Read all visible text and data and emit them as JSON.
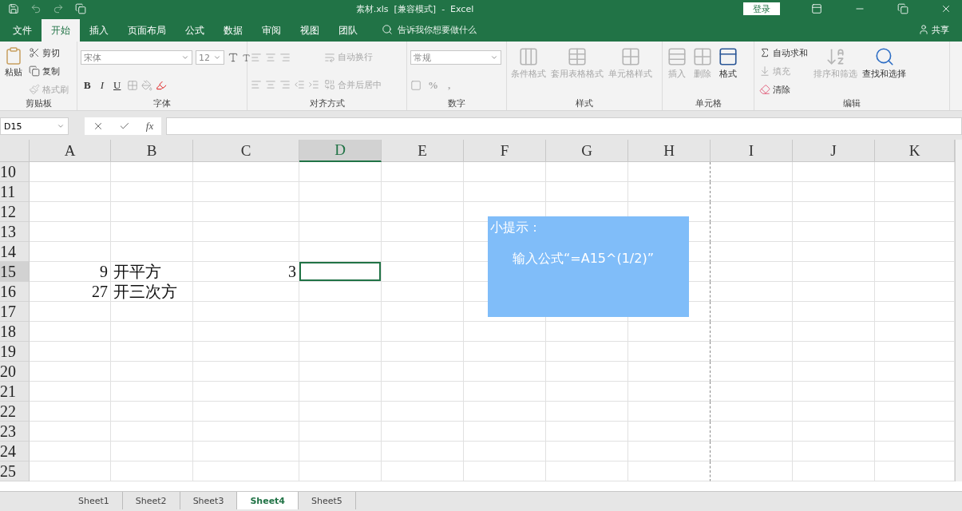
{
  "window": {
    "title": "素材.xls  [兼容模式]  -  Excel",
    "login": "登录"
  },
  "menu_tabs": [
    {
      "label": "文件",
      "selected": false
    },
    {
      "label": "开始",
      "selected": true
    },
    {
      "label": "插入",
      "selected": false
    },
    {
      "label": "页面布局",
      "selected": false
    },
    {
      "label": "公式",
      "selected": false
    },
    {
      "label": "数据",
      "selected": false
    },
    {
      "label": "审阅",
      "selected": false
    },
    {
      "label": "视图",
      "selected": false
    },
    {
      "label": "团队",
      "selected": false
    }
  ],
  "tell_me": {
    "placeholder": "告诉我你想要做什么"
  },
  "share": "共享",
  "ribbon": [
    {
      "kind": "clipboard",
      "label": "剪贴板",
      "items": [
        {
          "label": "粘贴",
          "disabled": false
        },
        {
          "label": "剪切",
          "disabled": false
        },
        {
          "label": "复制",
          "disabled": false
        },
        {
          "label": "格式刷",
          "disabled": true
        }
      ]
    },
    {
      "kind": "font",
      "label": "字体",
      "font": "宋体",
      "size": "12",
      "items": [
        {
          "label": "B",
          "disabled": false
        },
        {
          "label": "I",
          "disabled": false
        },
        {
          "label": "U",
          "disabled": false
        }
      ]
    },
    {
      "kind": "align",
      "label": "对齐方式",
      "items": [
        {
          "label": "自动换行",
          "disabled": true
        },
        {
          "label": "合并后居中",
          "disabled": true
        }
      ]
    },
    {
      "kind": "number",
      "label": "数字",
      "format": "常规",
      "items": [
        {
          "label": "%",
          "disabled": true
        },
        {
          "label": ",",
          "disabled": true
        }
      ]
    },
    {
      "kind": "large",
      "label": "样式",
      "items": [
        {
          "label": "条件格式",
          "disabled": true
        },
        {
          "label": "套用表格格式",
          "disabled": true
        },
        {
          "label": "单元格样式",
          "disabled": true
        }
      ]
    },
    {
      "kind": "large",
      "label": "单元格",
      "items": [
        {
          "label": "插入",
          "disabled": true
        },
        {
          "label": "删除",
          "disabled": true
        },
        {
          "label": "格式",
          "disabled": false
        }
      ]
    },
    {
      "kind": "editing",
      "label": "编辑",
      "items": [
        {
          "label": "自动求和",
          "disabled": false
        },
        {
          "label": "填充",
          "disabled": true
        },
        {
          "label": "清除",
          "disabled": false
        },
        {
          "label": "排序和筛选",
          "disabled": true
        },
        {
          "label": "查找和选择",
          "disabled": false
        }
      ]
    }
  ],
  "formula_bar": {
    "name_box": "D15",
    "fx_label": "fx"
  },
  "sheet": {
    "columns": [
      {
        "label": "A",
        "selected": false,
        "page_break": false
      },
      {
        "label": "B",
        "selected": false,
        "page_break": false
      },
      {
        "label": "C",
        "selected": false,
        "page_break": false
      },
      {
        "label": "D",
        "selected": true,
        "page_break": false
      },
      {
        "label": "E",
        "selected": false,
        "page_break": false
      },
      {
        "label": "F",
        "selected": false,
        "page_break": false
      },
      {
        "label": "G",
        "selected": false,
        "page_break": false
      },
      {
        "label": "H",
        "selected": false,
        "page_break": true
      },
      {
        "label": "I",
        "selected": false,
        "page_break": false
      },
      {
        "label": "J",
        "selected": false,
        "page_break": false
      },
      {
        "label": "K",
        "selected": false,
        "page_break": false
      }
    ],
    "rows": [
      {
        "number": "10",
        "selected": false
      },
      {
        "number": "11",
        "selected": false
      },
      {
        "number": "12",
        "selected": false
      },
      {
        "number": "13",
        "selected": false
      },
      {
        "number": "14",
        "selected": false
      },
      {
        "number": "15",
        "selected": true,
        "cells": [
          {
            "text": "9",
            "kind": "number"
          },
          {
            "text": "开平方",
            "kind": "text"
          },
          {
            "text": "3",
            "kind": "number"
          }
        ]
      },
      {
        "number": "16",
        "selected": false,
        "cells": [
          {
            "text": "27",
            "kind": "number"
          },
          {
            "text": "开三次方",
            "kind": "text"
          }
        ]
      },
      {
        "number": "17",
        "selected": false
      },
      {
        "number": "18",
        "selected": false
      },
      {
        "number": "19",
        "selected": false
      },
      {
        "number": "20",
        "selected": false
      },
      {
        "number": "21",
        "selected": false
      },
      {
        "number": "22",
        "selected": false
      },
      {
        "number": "23",
        "selected": false
      },
      {
        "number": "24",
        "selected": false
      },
      {
        "number": "25",
        "selected": false
      }
    ]
  },
  "note": {
    "title": "小提示：",
    "body": "输入公式“=A15^(1/2)”"
  },
  "sheet_tabs": [
    {
      "label": "Sheet1",
      "selected": false
    },
    {
      "label": "Sheet2",
      "selected": false
    },
    {
      "label": "Sheet3",
      "selected": false
    },
    {
      "label": "Sheet4",
      "selected": true
    },
    {
      "label": "Sheet5",
      "selected": false
    }
  ]
}
